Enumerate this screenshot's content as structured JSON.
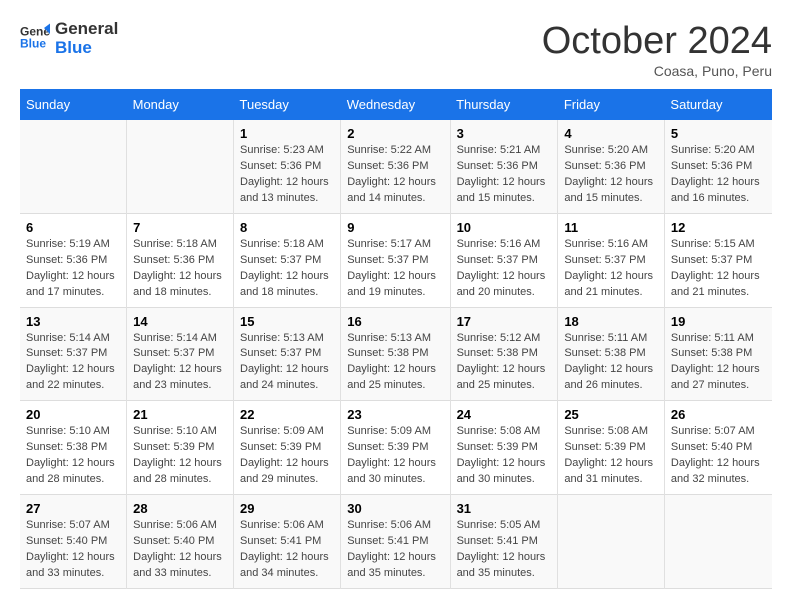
{
  "header": {
    "logo_line1": "General",
    "logo_line2": "Blue",
    "month_title": "October 2024",
    "location": "Coasa, Puno, Peru"
  },
  "weekdays": [
    "Sunday",
    "Monday",
    "Tuesday",
    "Wednesday",
    "Thursday",
    "Friday",
    "Saturday"
  ],
  "weeks": [
    [
      {
        "day": "",
        "sunrise": "",
        "sunset": "",
        "daylight": ""
      },
      {
        "day": "",
        "sunrise": "",
        "sunset": "",
        "daylight": ""
      },
      {
        "day": "1",
        "sunrise": "Sunrise: 5:23 AM",
        "sunset": "Sunset: 5:36 PM",
        "daylight": "Daylight: 12 hours and 13 minutes."
      },
      {
        "day": "2",
        "sunrise": "Sunrise: 5:22 AM",
        "sunset": "Sunset: 5:36 PM",
        "daylight": "Daylight: 12 hours and 14 minutes."
      },
      {
        "day": "3",
        "sunrise": "Sunrise: 5:21 AM",
        "sunset": "Sunset: 5:36 PM",
        "daylight": "Daylight: 12 hours and 15 minutes."
      },
      {
        "day": "4",
        "sunrise": "Sunrise: 5:20 AM",
        "sunset": "Sunset: 5:36 PM",
        "daylight": "Daylight: 12 hours and 15 minutes."
      },
      {
        "day": "5",
        "sunrise": "Sunrise: 5:20 AM",
        "sunset": "Sunset: 5:36 PM",
        "daylight": "Daylight: 12 hours and 16 minutes."
      }
    ],
    [
      {
        "day": "6",
        "sunrise": "Sunrise: 5:19 AM",
        "sunset": "Sunset: 5:36 PM",
        "daylight": "Daylight: 12 hours and 17 minutes."
      },
      {
        "day": "7",
        "sunrise": "Sunrise: 5:18 AM",
        "sunset": "Sunset: 5:36 PM",
        "daylight": "Daylight: 12 hours and 18 minutes."
      },
      {
        "day": "8",
        "sunrise": "Sunrise: 5:18 AM",
        "sunset": "Sunset: 5:37 PM",
        "daylight": "Daylight: 12 hours and 18 minutes."
      },
      {
        "day": "9",
        "sunrise": "Sunrise: 5:17 AM",
        "sunset": "Sunset: 5:37 PM",
        "daylight": "Daylight: 12 hours and 19 minutes."
      },
      {
        "day": "10",
        "sunrise": "Sunrise: 5:16 AM",
        "sunset": "Sunset: 5:37 PM",
        "daylight": "Daylight: 12 hours and 20 minutes."
      },
      {
        "day": "11",
        "sunrise": "Sunrise: 5:16 AM",
        "sunset": "Sunset: 5:37 PM",
        "daylight": "Daylight: 12 hours and 21 minutes."
      },
      {
        "day": "12",
        "sunrise": "Sunrise: 5:15 AM",
        "sunset": "Sunset: 5:37 PM",
        "daylight": "Daylight: 12 hours and 21 minutes."
      }
    ],
    [
      {
        "day": "13",
        "sunrise": "Sunrise: 5:14 AM",
        "sunset": "Sunset: 5:37 PM",
        "daylight": "Daylight: 12 hours and 22 minutes."
      },
      {
        "day": "14",
        "sunrise": "Sunrise: 5:14 AM",
        "sunset": "Sunset: 5:37 PM",
        "daylight": "Daylight: 12 hours and 23 minutes."
      },
      {
        "day": "15",
        "sunrise": "Sunrise: 5:13 AM",
        "sunset": "Sunset: 5:37 PM",
        "daylight": "Daylight: 12 hours and 24 minutes."
      },
      {
        "day": "16",
        "sunrise": "Sunrise: 5:13 AM",
        "sunset": "Sunset: 5:38 PM",
        "daylight": "Daylight: 12 hours and 25 minutes."
      },
      {
        "day": "17",
        "sunrise": "Sunrise: 5:12 AM",
        "sunset": "Sunset: 5:38 PM",
        "daylight": "Daylight: 12 hours and 25 minutes."
      },
      {
        "day": "18",
        "sunrise": "Sunrise: 5:11 AM",
        "sunset": "Sunset: 5:38 PM",
        "daylight": "Daylight: 12 hours and 26 minutes."
      },
      {
        "day": "19",
        "sunrise": "Sunrise: 5:11 AM",
        "sunset": "Sunset: 5:38 PM",
        "daylight": "Daylight: 12 hours and 27 minutes."
      }
    ],
    [
      {
        "day": "20",
        "sunrise": "Sunrise: 5:10 AM",
        "sunset": "Sunset: 5:38 PM",
        "daylight": "Daylight: 12 hours and 28 minutes."
      },
      {
        "day": "21",
        "sunrise": "Sunrise: 5:10 AM",
        "sunset": "Sunset: 5:39 PM",
        "daylight": "Daylight: 12 hours and 28 minutes."
      },
      {
        "day": "22",
        "sunrise": "Sunrise: 5:09 AM",
        "sunset": "Sunset: 5:39 PM",
        "daylight": "Daylight: 12 hours and 29 minutes."
      },
      {
        "day": "23",
        "sunrise": "Sunrise: 5:09 AM",
        "sunset": "Sunset: 5:39 PM",
        "daylight": "Daylight: 12 hours and 30 minutes."
      },
      {
        "day": "24",
        "sunrise": "Sunrise: 5:08 AM",
        "sunset": "Sunset: 5:39 PM",
        "daylight": "Daylight: 12 hours and 30 minutes."
      },
      {
        "day": "25",
        "sunrise": "Sunrise: 5:08 AM",
        "sunset": "Sunset: 5:39 PM",
        "daylight": "Daylight: 12 hours and 31 minutes."
      },
      {
        "day": "26",
        "sunrise": "Sunrise: 5:07 AM",
        "sunset": "Sunset: 5:40 PM",
        "daylight": "Daylight: 12 hours and 32 minutes."
      }
    ],
    [
      {
        "day": "27",
        "sunrise": "Sunrise: 5:07 AM",
        "sunset": "Sunset: 5:40 PM",
        "daylight": "Daylight: 12 hours and 33 minutes."
      },
      {
        "day": "28",
        "sunrise": "Sunrise: 5:06 AM",
        "sunset": "Sunset: 5:40 PM",
        "daylight": "Daylight: 12 hours and 33 minutes."
      },
      {
        "day": "29",
        "sunrise": "Sunrise: 5:06 AM",
        "sunset": "Sunset: 5:41 PM",
        "daylight": "Daylight: 12 hours and 34 minutes."
      },
      {
        "day": "30",
        "sunrise": "Sunrise: 5:06 AM",
        "sunset": "Sunset: 5:41 PM",
        "daylight": "Daylight: 12 hours and 35 minutes."
      },
      {
        "day": "31",
        "sunrise": "Sunrise: 5:05 AM",
        "sunset": "Sunset: 5:41 PM",
        "daylight": "Daylight: 12 hours and 35 minutes."
      },
      {
        "day": "",
        "sunrise": "",
        "sunset": "",
        "daylight": ""
      },
      {
        "day": "",
        "sunrise": "",
        "sunset": "",
        "daylight": ""
      }
    ]
  ]
}
